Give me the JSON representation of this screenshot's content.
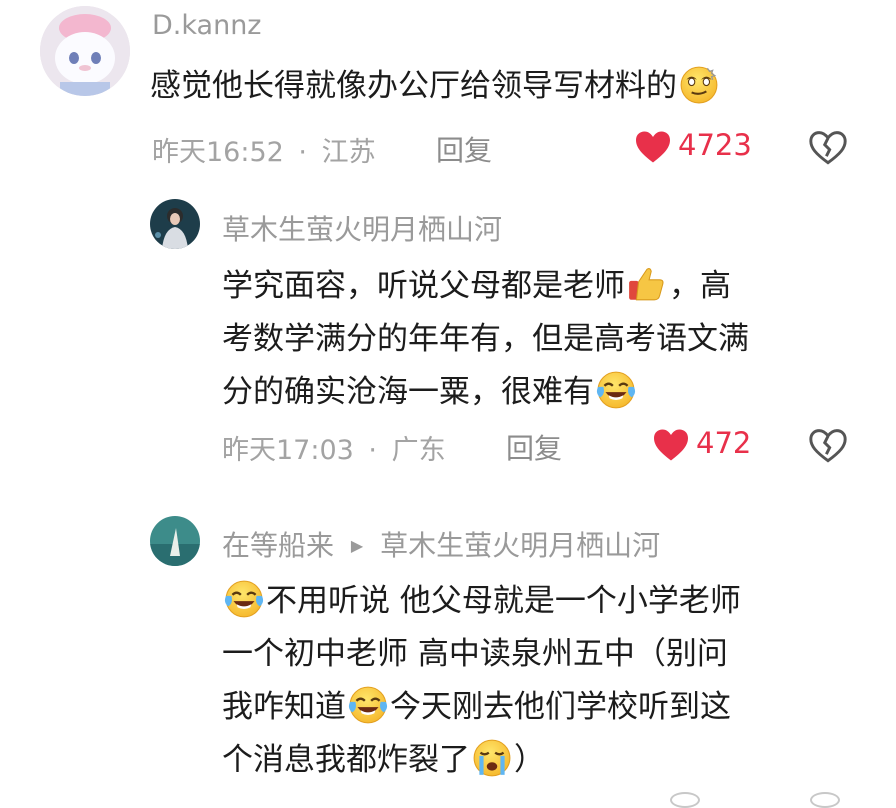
{
  "comments": [
    {
      "username": "D.kannz",
      "lines": [
        "感觉他长得就像办公厅给领导写材料的"
      ],
      "time": "昨天16:52",
      "location": "江苏",
      "reply_label": "回复",
      "likes": "4723"
    },
    {
      "username": "草木生萤火明月栖山河",
      "lines": [
        "学究面容，听说父母都是老师",
        "，高",
        "考数学满分的年年有，但是高考语文满",
        "分的确实沧海一粟，很难有"
      ],
      "time": "昨天17:03",
      "location": "广东",
      "reply_label": "回复",
      "likes": "472"
    },
    {
      "username": "在等船来",
      "reply_to": "草木生萤火明月栖山河",
      "lines": [
        "不用听说 他父母就是一个小学老师",
        "一个初中老师 高中读泉州五中（别问",
        "我咋知道",
        "今天刚去他们学校听到这",
        "个消息我都炸裂了",
        "）"
      ]
    }
  ],
  "separator": "·",
  "colors": {
    "like_red": "#e8304a",
    "meta_gray": "#a3a3a3"
  },
  "icons": [
    "heart-filled-icon",
    "dislike-broken-heart-icon",
    "reply-arrow-icon",
    "emoji-dizzy",
    "emoji-thumbs-up",
    "emoji-laugh-cry",
    "emoji-crying"
  ]
}
